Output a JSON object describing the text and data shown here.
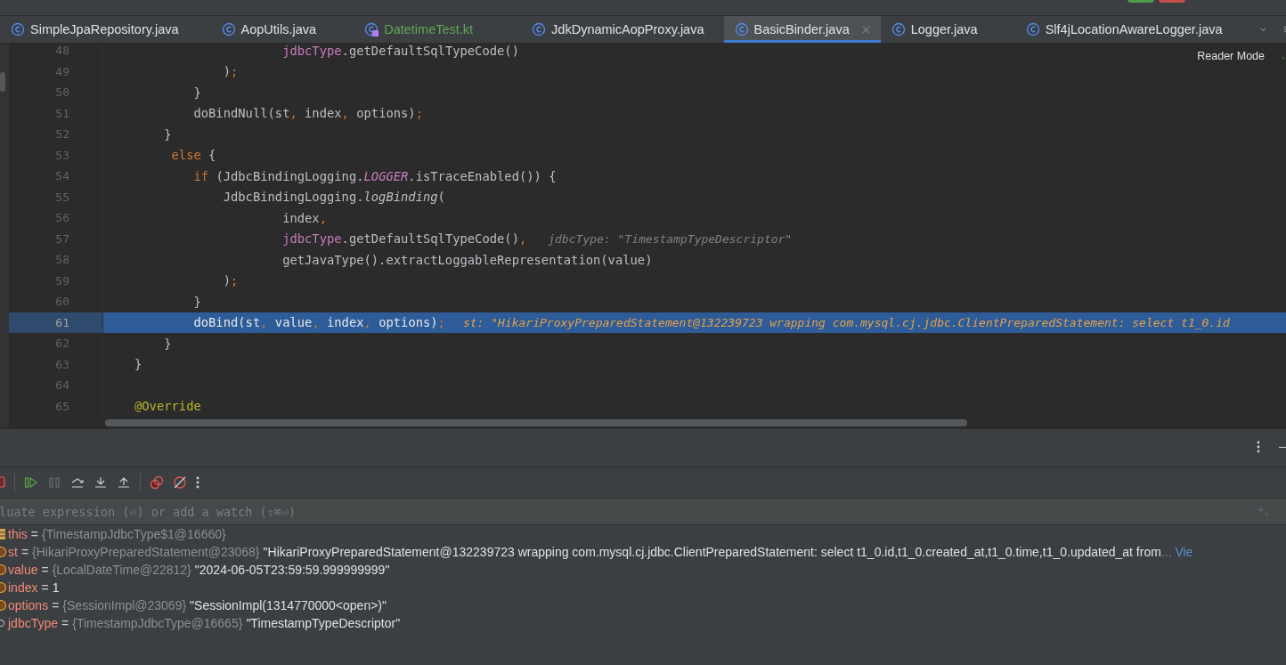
{
  "tabs": [
    {
      "label": "SimpleJpaRepository.java",
      "kind": "class",
      "added": false,
      "selected": false
    },
    {
      "label": "AopUtils.java",
      "kind": "class",
      "added": false,
      "selected": false
    },
    {
      "label": "DatetimeTest.kt",
      "kind": "kotlin-test",
      "added": true,
      "selected": false
    },
    {
      "label": "JdkDynamicAopProxy.java",
      "kind": "class",
      "added": false,
      "selected": false
    },
    {
      "label": "BasicBinder.java",
      "kind": "class",
      "added": false,
      "selected": true
    },
    {
      "label": "Logger.java",
      "kind": "class",
      "added": false,
      "selected": false
    },
    {
      "label": "Slf4jLocationAwareLogger.java",
      "kind": "class",
      "added": false,
      "selected": false
    }
  ],
  "editor": {
    "reader_mode": "Reader Mode",
    "lines": [
      {
        "number": "48",
        "selected": false,
        "tokens": [
          {
            "kind": "field",
            "text": "                    jdbcType"
          },
          {
            "kind": "plain",
            "text": ".getDefaultSqlTypeCode()"
          }
        ]
      },
      {
        "number": "49",
        "selected": false,
        "tokens": [
          {
            "kind": "plain",
            "text": "            )"
          },
          {
            "kind": "punct",
            "text": ";"
          }
        ]
      },
      {
        "number": "50",
        "selected": false,
        "tokens": [
          {
            "kind": "plain",
            "text": "        }"
          }
        ]
      },
      {
        "number": "51",
        "selected": false,
        "tokens": [
          {
            "kind": "plain",
            "text": "        doBindNull(st"
          },
          {
            "kind": "punct",
            "text": ","
          },
          {
            "kind": "plain",
            "text": " index"
          },
          {
            "kind": "punct",
            "text": ","
          },
          {
            "kind": "plain",
            "text": " options)"
          },
          {
            "kind": "punct",
            "text": ";"
          }
        ]
      },
      {
        "number": "52",
        "selected": false,
        "tokens": [
          {
            "kind": "plain",
            "text": "    }"
          }
        ]
      },
      {
        "number": "53",
        "selected": false,
        "tokens": [
          {
            "kind": "keyword",
            "text": "     else"
          },
          {
            "kind": "plain",
            "text": " {"
          }
        ]
      },
      {
        "number": "54",
        "selected": false,
        "tokens": [
          {
            "kind": "keyword",
            "text": "        if"
          },
          {
            "kind": "plain",
            "text": " (JdbcBindingLogging."
          },
          {
            "kind": "static",
            "text": "LOGGER"
          },
          {
            "kind": "plain",
            "text": ".isTraceEnabled()) {"
          }
        ]
      },
      {
        "number": "55",
        "selected": false,
        "tokens": [
          {
            "kind": "plain",
            "text": "            JdbcBindingLogging."
          },
          {
            "kind": "call",
            "text": "logBinding"
          },
          {
            "kind": "plain",
            "text": "("
          }
        ]
      },
      {
        "number": "56",
        "selected": false,
        "tokens": [
          {
            "kind": "plain",
            "text": "                    index"
          },
          {
            "kind": "punct",
            "text": ","
          }
        ]
      },
      {
        "number": "57",
        "selected": false,
        "tokens": [
          {
            "kind": "field",
            "text": "                    jdbcType"
          },
          {
            "kind": "plain",
            "text": ".getDefaultSqlTypeCode()"
          },
          {
            "kind": "punct",
            "text": ","
          }
        ],
        "hint": "jdbcType: \"TimestampTypeDescriptor\""
      },
      {
        "number": "58",
        "selected": false,
        "tokens": [
          {
            "kind": "plain",
            "text": "                    getJavaType().extractLoggableRepresentation(value)"
          }
        ]
      },
      {
        "number": "59",
        "selected": false,
        "tokens": [
          {
            "kind": "plain",
            "text": "            )"
          },
          {
            "kind": "punct",
            "text": ";"
          }
        ]
      },
      {
        "number": "60",
        "selected": false,
        "tokens": [
          {
            "kind": "plain",
            "text": "        }"
          }
        ]
      },
      {
        "number": "61",
        "selected": true,
        "tokens": [
          {
            "kind": "plain",
            "text": "        doBind(st"
          },
          {
            "kind": "punct",
            "text": ","
          },
          {
            "kind": "plain",
            "text": " value"
          },
          {
            "kind": "punct",
            "text": ","
          },
          {
            "kind": "plain",
            "text": " index"
          },
          {
            "kind": "punct",
            "text": ","
          },
          {
            "kind": "plain",
            "text": " options)"
          },
          {
            "kind": "punct",
            "text": ";"
          }
        ],
        "hint": "st: \"HikariProxyPreparedStatement@132239723 wrapping com.mysql.cj.jdbc.ClientPreparedStatement: select t1_0.id"
      },
      {
        "number": "62",
        "selected": false,
        "tokens": [
          {
            "kind": "plain",
            "text": "    }"
          }
        ]
      },
      {
        "number": "63",
        "selected": false,
        "tokens": [
          {
            "kind": "plain",
            "text": "}"
          }
        ]
      },
      {
        "number": "64",
        "selected": false
      },
      {
        "number": "65",
        "selected": false,
        "tokens": [
          {
            "kind": "annotation",
            "text": "@Override"
          }
        ]
      }
    ]
  },
  "debugger": {
    "evaluate": {
      "placeholder": "luate expression (⏎) or add a watch (⇧⌘⏎)"
    },
    "variables": [
      {
        "kind": "this",
        "name": "this",
        "op": "=",
        "type": "{TimestampJdbcType$1@16660}"
      },
      {
        "kind": "param",
        "name": "st",
        "op": "=",
        "type": "{HikariProxyPreparedStatement@23068}",
        "value": "\"HikariProxyPreparedStatement@132239723 wrapping com.mysql.cj.jdbc.ClientPreparedStatement: select t1_0.id,t1_0.created_at,t1_0.time,t1_0.updated_at from",
        "link": "... Vie"
      },
      {
        "kind": "param",
        "name": "value",
        "op": "=",
        "type": "{LocalDateTime@22812}",
        "value": "\"2024-06-05T23:59:59.999999999\""
      },
      {
        "kind": "param",
        "name": "index",
        "op": "=",
        "plain": "1"
      },
      {
        "kind": "param",
        "name": "options",
        "op": "=",
        "type": "{SessionImpl@23069}",
        "value": "\"SessionImpl(1314770000<open>)\""
      },
      {
        "kind": "field",
        "name": "jdbcType",
        "op": "=",
        "type": "{TimestampJdbcType@16665}",
        "value": "\"TimestampTypeDescriptor\""
      }
    ]
  }
}
